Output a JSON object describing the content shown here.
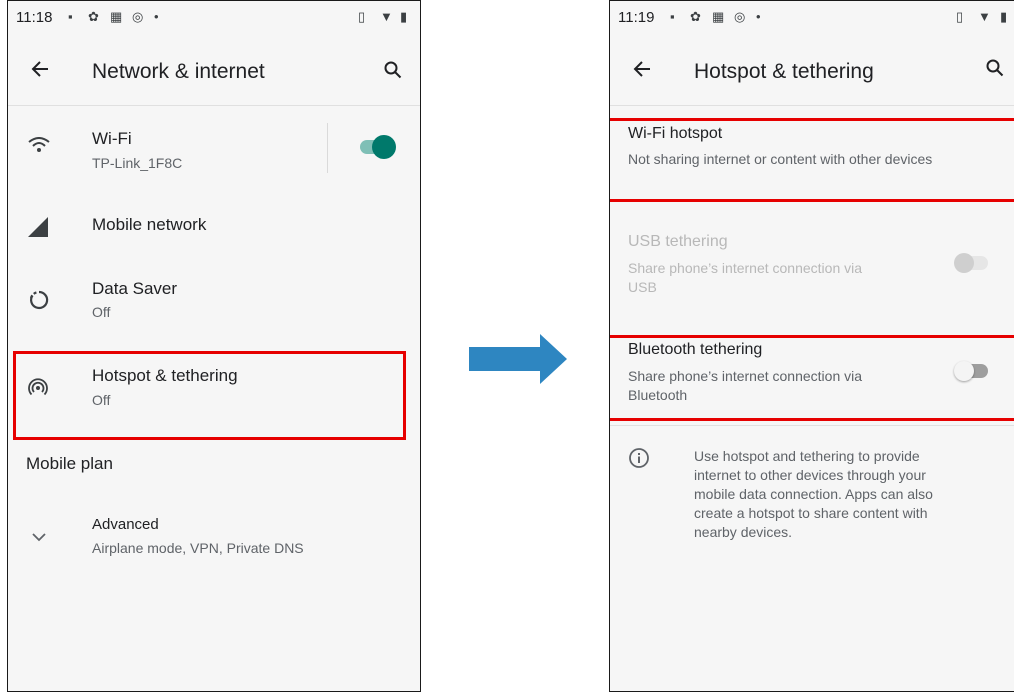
{
  "left": {
    "status_time": "11:18",
    "title": "Network & internet",
    "items": [
      {
        "title": "Wi-Fi",
        "subtitle": "TP-Link_1F8C"
      },
      {
        "title": "Mobile network",
        "subtitle": ""
      },
      {
        "title": "Data Saver",
        "subtitle": "Off"
      },
      {
        "title": "Hotspot & tethering",
        "subtitle": "Off"
      }
    ],
    "mobile_plan": "Mobile plan",
    "advanced": {
      "title": "Advanced",
      "subtitle": "Airplane mode, VPN, Private DNS"
    },
    "wifi_toggle_on": true
  },
  "right": {
    "status_time": "11:19",
    "title": "Hotspot & tethering",
    "wifi_hotspot": {
      "title": "Wi-Fi hotspot",
      "subtitle": "Not sharing internet or content with other devices"
    },
    "usb_tethering": {
      "title": "USB tethering",
      "subtitle_line1": "Share phone’s internet connection via",
      "subtitle_line2": "USB",
      "enabled": false
    },
    "bluetooth_tethering": {
      "title": "Bluetooth tethering",
      "subtitle_line1": "Share phone’s internet connection via",
      "subtitle_line2": "Bluetooth",
      "on": false
    },
    "info_lines": [
      "Use hotspot and tethering to provide",
      "internet to other devices through your",
      "mobile data connection. Apps can also",
      "create a hotspot to share content with",
      "nearby devices."
    ]
  },
  "colors": {
    "highlight": "#e60000",
    "accent": "#00796b",
    "arrow": "#2e86c1"
  }
}
